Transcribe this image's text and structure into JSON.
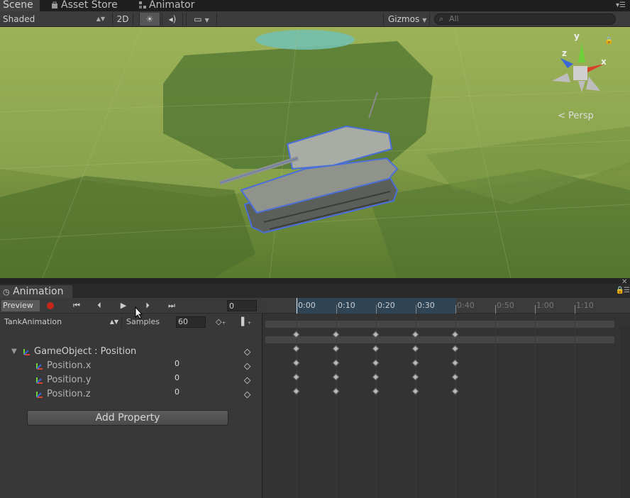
{
  "scene_window": {
    "tabs": [
      {
        "label": "Scene",
        "active": true
      },
      {
        "label": "Asset Store",
        "active": false
      },
      {
        "label": "Animator",
        "active": false
      }
    ],
    "toolbar": {
      "shading_mode": "Shaded",
      "mode_2d_label": "2D",
      "gizmos_label": "Gizmos",
      "search_placeholder": "All"
    },
    "gizmo": {
      "x_label": "x",
      "y_label": "y",
      "z_label": "z",
      "projection_label": "Persp"
    }
  },
  "animation_window": {
    "tab_label": "Animation",
    "controls": {
      "preview_label": "Preview",
      "current_frame": "0"
    },
    "clip_name": "TankAnimation",
    "samples_label": "Samples",
    "samples_value": "60",
    "properties": [
      {
        "label": "GameObject : Position",
        "value": "",
        "is_group": true
      },
      {
        "label": "Position.x",
        "value": "0",
        "is_group": false
      },
      {
        "label": "Position.y",
        "value": "0",
        "is_group": false
      },
      {
        "label": "Position.z",
        "value": "0",
        "is_group": false
      }
    ],
    "add_property_label": "Add Property",
    "timeline": {
      "tick_labels": [
        "0:00",
        "0:10",
        "0:20",
        "0:30",
        "0:40",
        "0:50",
        "1:00",
        "1:10"
      ],
      "keyframe_times": [
        "0:00",
        "0:10",
        "0:20",
        "0:30",
        "0:40"
      ]
    }
  },
  "colors": {
    "record_red": "#c8261b",
    "timeline_selection": "#2f4556",
    "selection_outline": "#4b6fd8"
  }
}
